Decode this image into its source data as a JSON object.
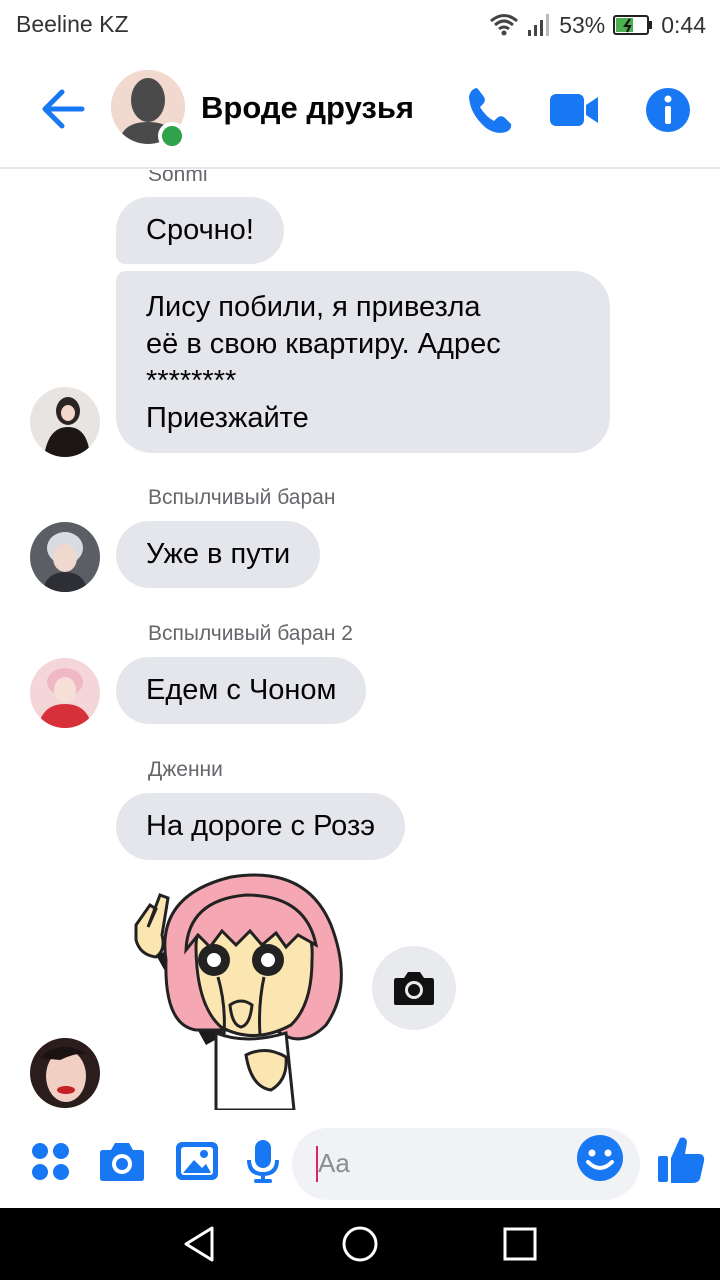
{
  "status_bar": {
    "carrier": "Beeline KZ",
    "battery_percent": "53%",
    "time": "0:44"
  },
  "header": {
    "title": "Вроде друзья",
    "online": true,
    "accent_color": "#0084ff"
  },
  "messages": [
    {
      "sender": "Sohmi",
      "text": "Срочно!"
    },
    {
      "sender": "Sohmi",
      "text": "Лису побили, я привезла\nеё в свою квартиру. Адрес\n********\nПриезжайте"
    },
    {
      "sender": "Вспылчивый баран",
      "text": "Уже в пути"
    },
    {
      "sender": "Вспылчивый баран 2",
      "text": "Едем с Чоном"
    },
    {
      "sender": "Дженни",
      "text": "На дороге с Розэ"
    },
    {
      "sender": "Дженни",
      "sticker": "crying-girl-peace-sign-sticker"
    }
  ],
  "composer": {
    "placeholder": "Aa"
  },
  "icons": {
    "back": "arrow-left-icon",
    "call": "phone-icon",
    "video": "video-camera-icon",
    "info": "info-icon",
    "more": "four-dots-icon",
    "camera": "camera-icon",
    "gallery": "image-icon",
    "voice": "microphone-icon",
    "emoji": "smiley-icon",
    "like": "thumbs-up-icon"
  }
}
